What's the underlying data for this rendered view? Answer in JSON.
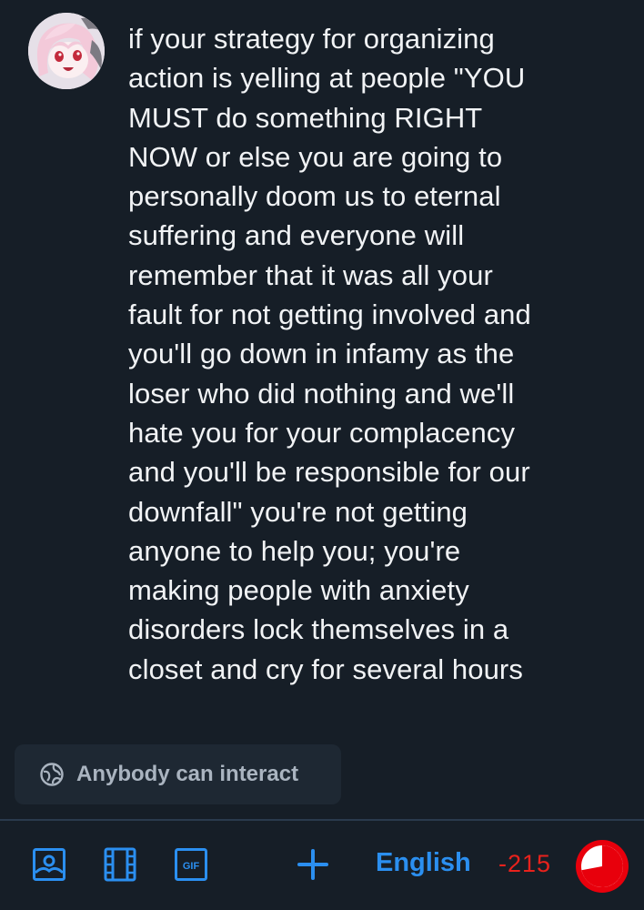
{
  "post": {
    "text": "if your strategy for organizing\naction is yelling at people \"YOU\nMUST do something RIGHT\nNOW or else you are going to\npersonally doom us to eternal\nsuffering and everyone will\nremember that it was all your\nfault for not getting involved and\nyou'll go down in infamy as the\nloser who did nothing and we'll\nhate you for your complacency\nand you'll be responsible for our\ndownfall\" you're not getting\nanyone to help you; you're\nmaking people with anxiety\ndisorders lock themselves in a\ncloset and cry for several hours"
  },
  "interaction": {
    "label": "Anybody can interact",
    "icon": "globe-icon"
  },
  "toolbar": {
    "image_icon": "image-icon",
    "video_icon": "film-icon",
    "gif_icon": "gif-icon",
    "gif_text": "GIF",
    "add_icon": "plus-icon",
    "language": "English",
    "char_counter": "-215",
    "char_limit_overflow_fraction": 0.72
  },
  "colors": {
    "background": "#161e27",
    "accent": "#2b8ff0",
    "error": "#e8221c",
    "pill_background": "#1e2833",
    "muted_text": "#aab4c0"
  }
}
